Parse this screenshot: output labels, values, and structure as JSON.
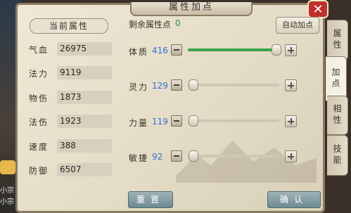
{
  "window": {
    "title": "属性加点",
    "close_symbol": "✕"
  },
  "left_panel": {
    "header": "当前属性",
    "stats": [
      {
        "label": "气血",
        "value": "26975"
      },
      {
        "label": "法力",
        "value": "9119"
      },
      {
        "label": "物伤",
        "value": "1873"
      },
      {
        "label": "法伤",
        "value": "1923"
      },
      {
        "label": "速度",
        "value": "388"
      },
      {
        "label": "防御",
        "value": "6507"
      }
    ]
  },
  "points": {
    "label": "剩余属性点",
    "value": "0",
    "auto_button": "自动加点"
  },
  "attributes": [
    {
      "label": "体质",
      "value": "416",
      "fraction": 1.0
    },
    {
      "label": "灵力",
      "value": "129",
      "fraction": 0.0
    },
    {
      "label": "力量",
      "value": "119",
      "fraction": 0.0
    },
    {
      "label": "敏捷",
      "value": "92",
      "fraction": 0.0
    }
  ],
  "buttons": {
    "reset": "重置",
    "confirm": "确认"
  },
  "tabs": [
    "属性",
    "加点",
    "相性",
    "技能"
  ],
  "side": {
    "lines": [
      "小宗",
      "小宗"
    ]
  },
  "colors": {
    "accent_green": "#3aa34a",
    "value_blue": "#2f6fd6",
    "close_red": "#c0302a"
  }
}
